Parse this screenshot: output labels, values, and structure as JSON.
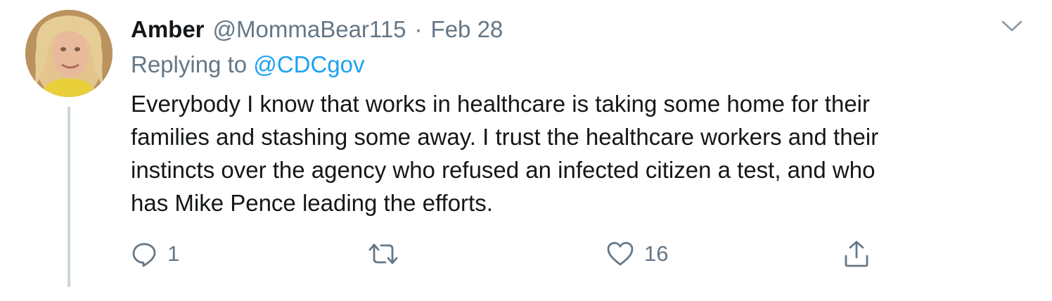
{
  "tweet": {
    "author_name": "Amber",
    "author_handle": "@MommaBear115",
    "separator": "·",
    "date": "Feb 28",
    "replying_prefix": "Replying to",
    "replying_to": "@CDCgov",
    "text_lines": [
      "Everybody I know that works in healthcare is taking some home for their",
      "families and stashing some away. I trust the healthcare workers and their",
      "instincts over the agency who refused an infected citizen a test, and who",
      "has Mike Pence leading the efforts."
    ],
    "actions": {
      "reply_icon": "reply-icon",
      "reply_count": "1",
      "retweet_icon": "retweet-icon",
      "retweet_count": "",
      "like_icon": "heart-icon",
      "like_count": "16",
      "share_icon": "share-icon"
    },
    "colors": {
      "text": "#14171a",
      "secondary": "#657786",
      "link": "#1da1f2",
      "thread_line": "#ccd6dd"
    }
  }
}
